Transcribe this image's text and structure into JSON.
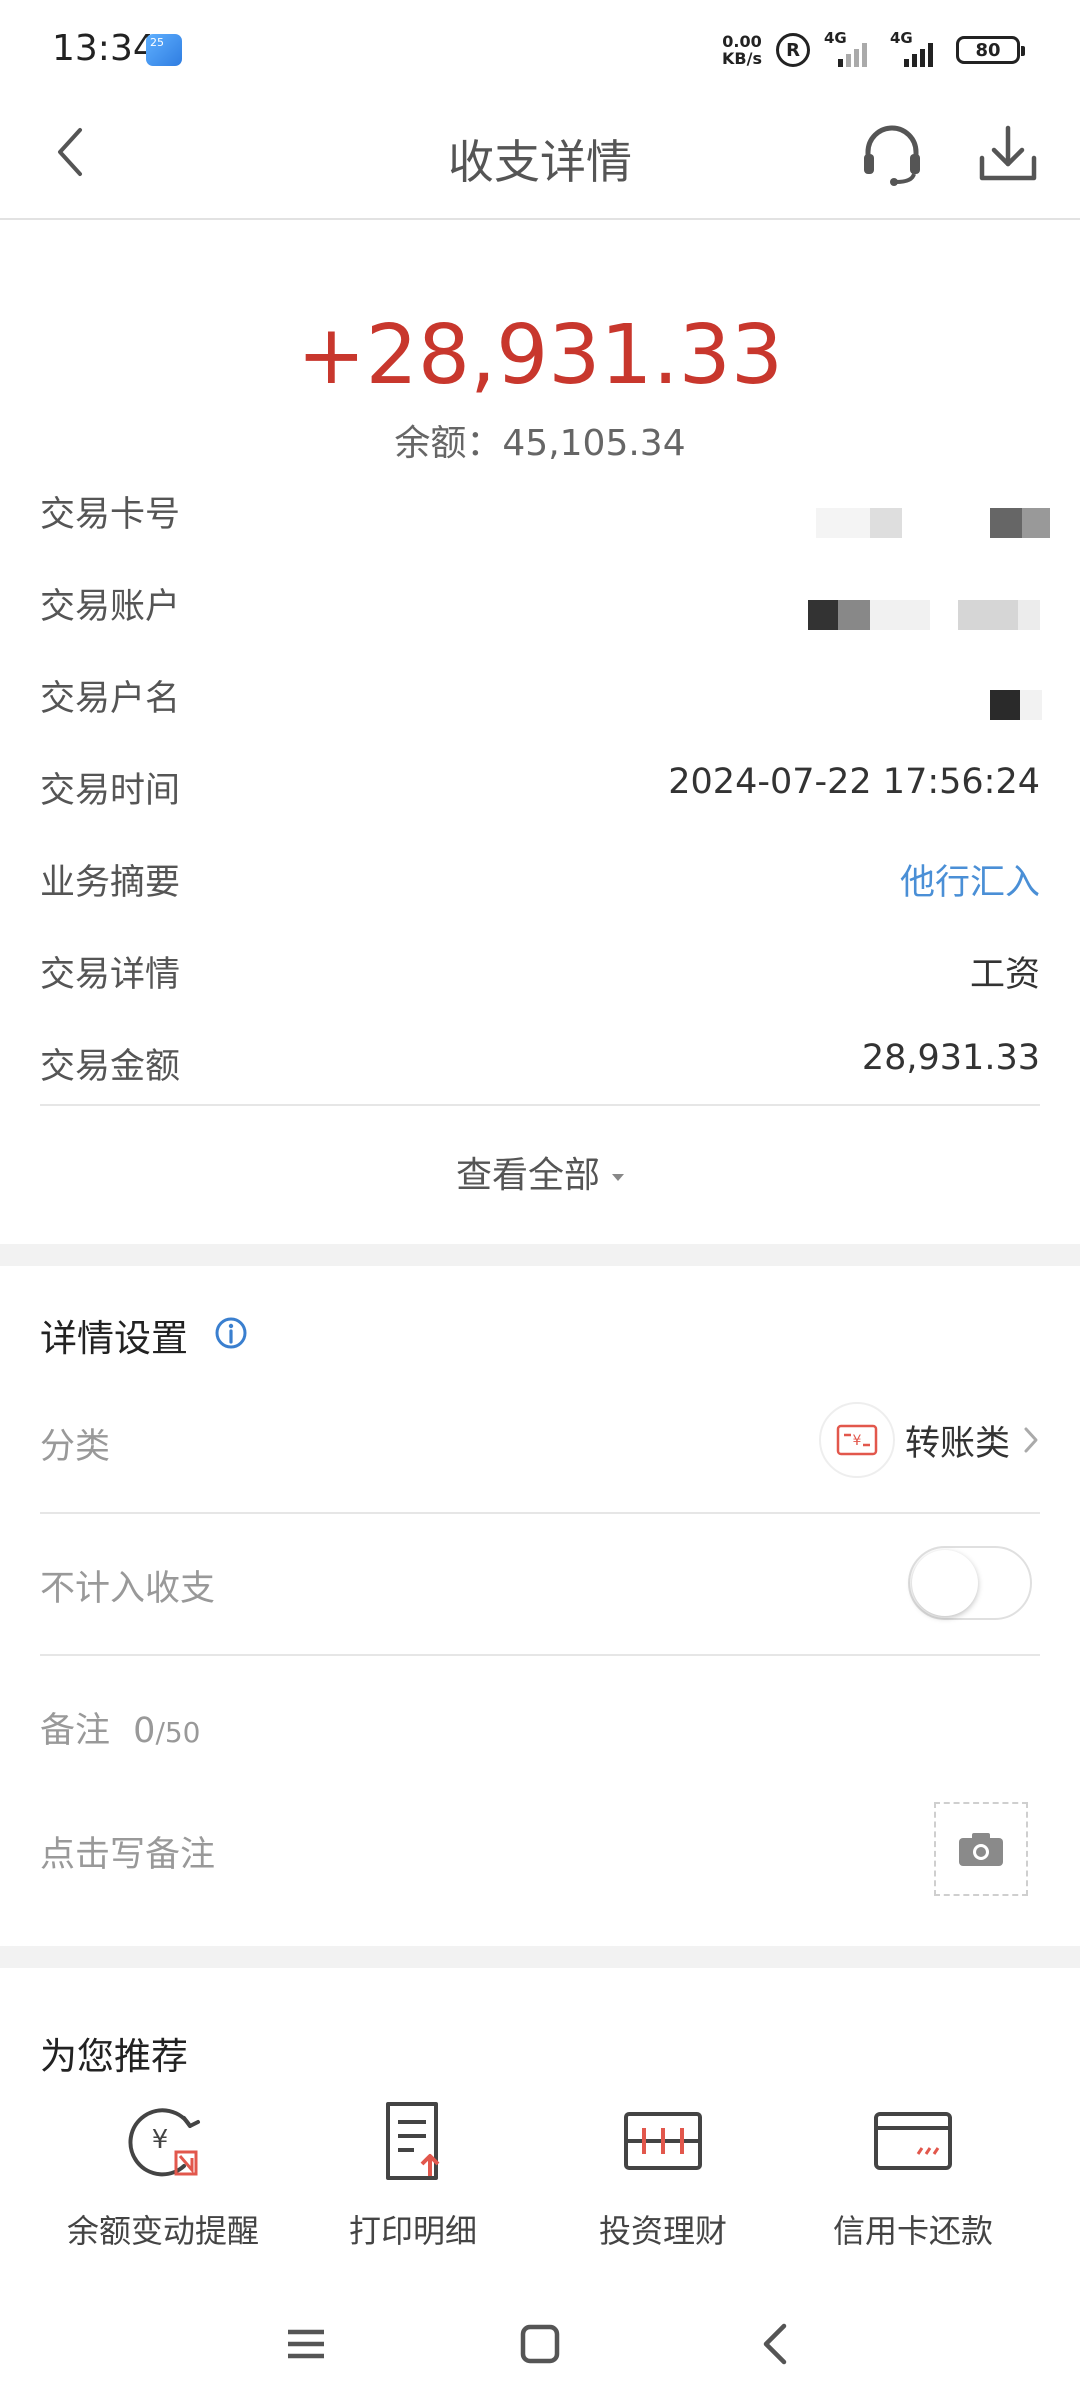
{
  "status_bar": {
    "time": "13:34",
    "weather_badge": "25",
    "net_speed_value": "0.00",
    "net_speed_unit": "KB/s",
    "r_badge": "R",
    "signal1": "4G",
    "signal2": "4G",
    "battery": "80"
  },
  "header": {
    "title": "收支详情",
    "back_icon": "chevron-left-icon",
    "support_icon": "headset-icon",
    "download_icon": "download-icon"
  },
  "summary": {
    "amount": "+28,931.33",
    "balance": "余额：45,105.34",
    "amount_color": "#c8372d"
  },
  "details": [
    {
      "label": "交易卡号",
      "value": ""
    },
    {
      "label": "交易账户",
      "value": ""
    },
    {
      "label": "交易户名",
      "value": ""
    },
    {
      "label": "交易时间",
      "value": "2024-07-22 17:56:24"
    },
    {
      "label": "业务摘要",
      "value": "他行汇入"
    },
    {
      "label": "交易详情",
      "value": "工资"
    },
    {
      "label": "交易金额",
      "value": "28,931.33"
    }
  ],
  "view_all": "查看全部",
  "settings": {
    "title": "详情设置",
    "category_label": "分类",
    "category_value": "转账类",
    "exclude_label": "不计入收支",
    "exclude_on": false,
    "memo_label": "备注",
    "memo_count": "0",
    "memo_max": "/50",
    "memo_placeholder": "点击写备注"
  },
  "recommend": {
    "title": "为您推荐",
    "items": [
      {
        "label": "余额变动提醒",
        "icon": "balance-alert-icon"
      },
      {
        "label": "打印明细",
        "icon": "print-detail-icon"
      },
      {
        "label": "投资理财",
        "icon": "investment-icon"
      },
      {
        "label": "信用卡还款",
        "icon": "credit-card-icon"
      }
    ]
  },
  "colors": {
    "accent_red": "#c8372d",
    "link_blue": "#4a8fd6"
  }
}
